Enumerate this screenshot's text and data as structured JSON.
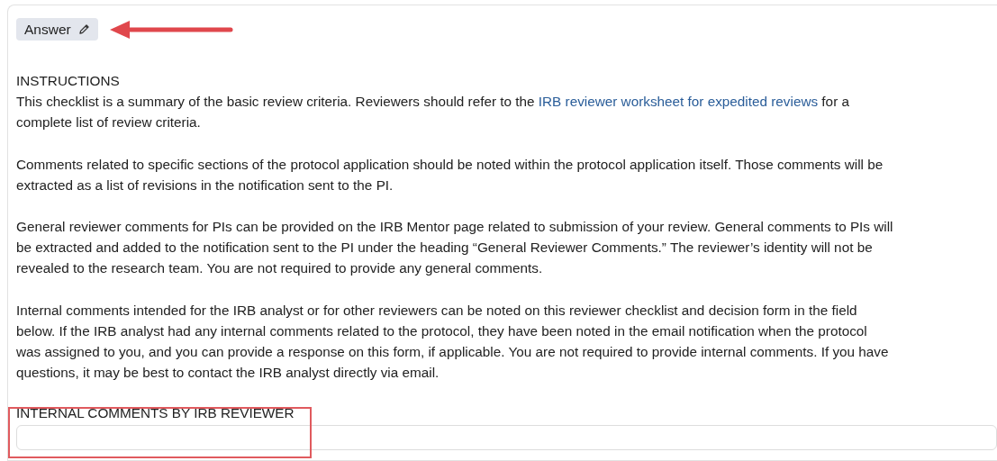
{
  "answer_chip": {
    "label": "Answer"
  },
  "instructions": {
    "heading": "INSTRUCTIONS",
    "paragraphs": [
      {
        "lines": [
          {
            "kind": "link_line",
            "before": "This checklist is a summary of the basic review criteria. Reviewers should refer to the ",
            "link": "IRB reviewer worksheet for expedited reviews",
            "after": " for a"
          },
          {
            "kind": "plain",
            "text": "complete list of review criteria."
          }
        ]
      },
      {
        "lines": [
          {
            "kind": "plain",
            "text": "Comments related to specific sections of the protocol application should be noted within the protocol application itself. Those comments will be"
          },
          {
            "kind": "plain",
            "text": "extracted as a list of revisions in the notification sent to the PI."
          }
        ]
      },
      {
        "lines": [
          {
            "kind": "plain",
            "text": "General reviewer comments for PIs can be provided on the IRB Mentor page related to submission of your review. General comments to PIs will"
          },
          {
            "kind": "plain",
            "text": "be extracted and added to the notification sent to the PI under the heading “General Reviewer Comments.” The reviewer’s identity will not be"
          },
          {
            "kind": "plain",
            "text": "revealed to the research team. You are not required to provide any general comments."
          }
        ]
      },
      {
        "lines": [
          {
            "kind": "plain",
            "text": "Internal comments intended for the IRB analyst or for other reviewers can be noted on this reviewer checklist and decision form in the field"
          },
          {
            "kind": "plain",
            "text": "below.  If the IRB analyst had any internal comments related to the protocol, they have been noted in the email notification when the protocol"
          },
          {
            "kind": "plain",
            "text": "was assigned to you, and you can provide a response on this form, if applicable. You are not required to provide internal comments. If you have"
          },
          {
            "kind": "plain",
            "text": "questions, it may be best to contact the IRB analyst directly via email."
          }
        ]
      }
    ]
  },
  "internal_comments": {
    "label": "INTERNAL COMMENTS BY IRB REVIEWER"
  }
}
